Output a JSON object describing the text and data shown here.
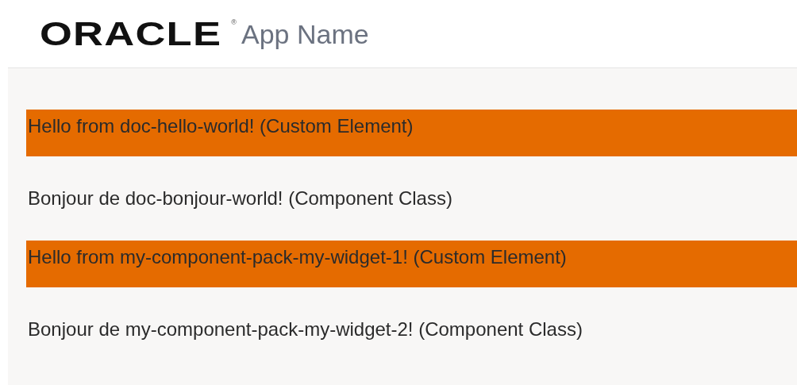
{
  "header": {
    "logo": "ORACLE",
    "logo_mark": "®",
    "app_name": "App Name"
  },
  "rows": [
    {
      "kind": "custom-element",
      "text": "Hello from doc-hello-world! (Custom Element)"
    },
    {
      "kind": "component-class",
      "text": "Bonjour de doc-bonjour-world! (Component Class)"
    },
    {
      "kind": "custom-element",
      "text": "Hello from my-component-pack-my-widget-1! (Custom Element)"
    },
    {
      "kind": "component-class",
      "text": "Bonjour de my-component-pack-my-widget-2! (Component Class)"
    }
  ]
}
